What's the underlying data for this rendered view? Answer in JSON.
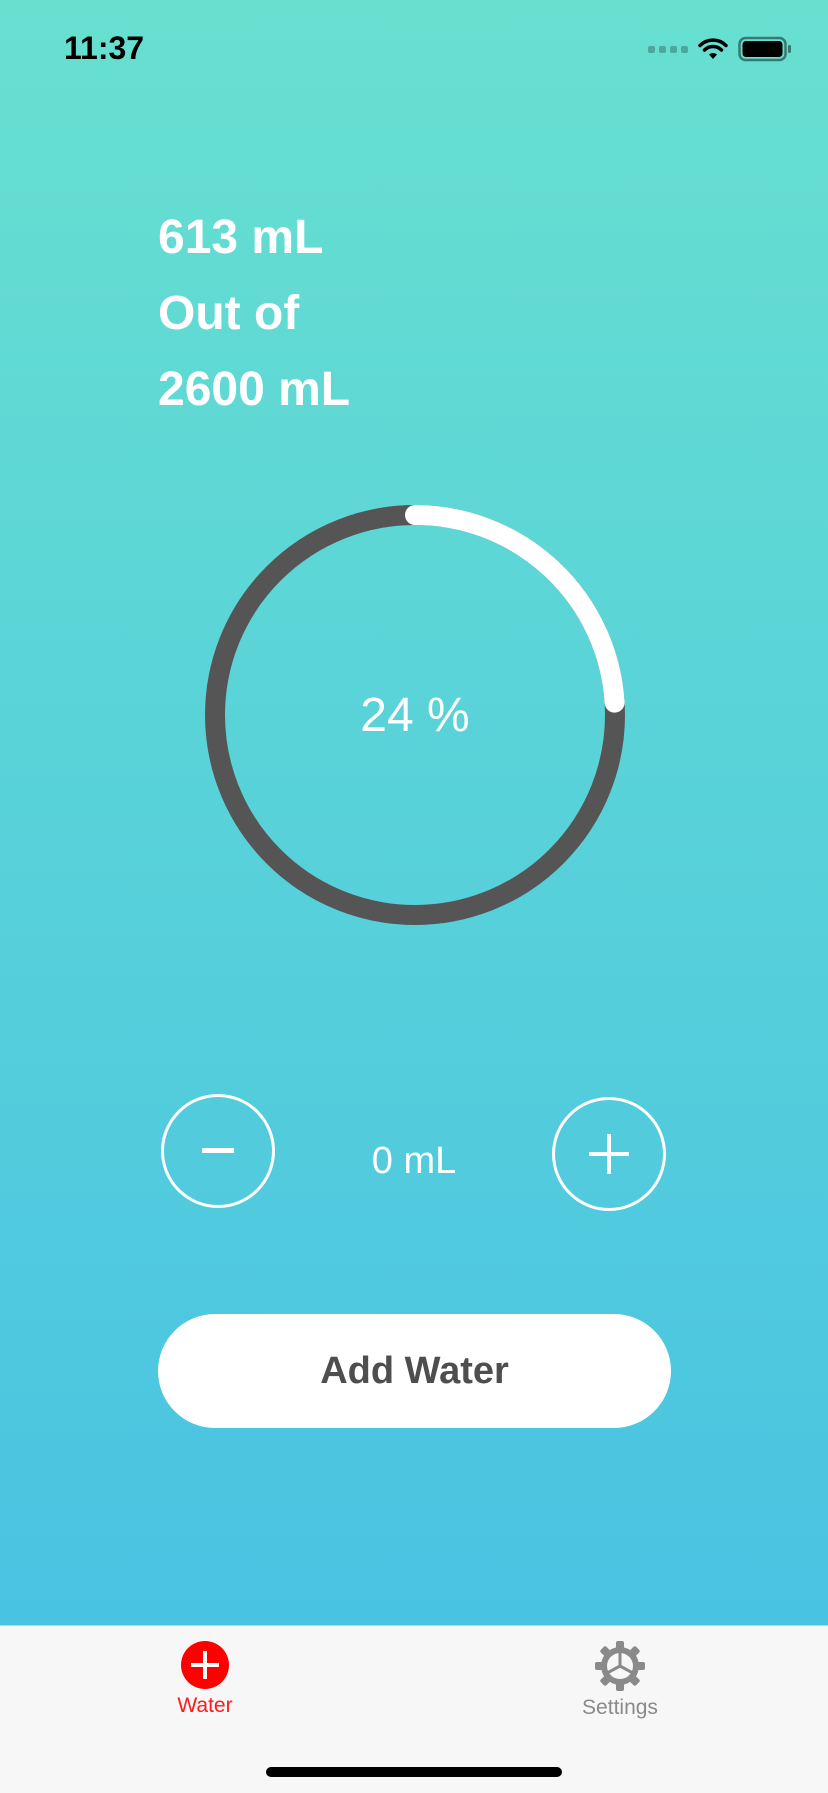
{
  "status_bar": {
    "time": "11:37"
  },
  "stats": {
    "consumed": "613 mL",
    "out_of_label": "Out of",
    "goal": "2600 mL"
  },
  "progress": {
    "label": "24 %",
    "fraction": 0.24
  },
  "stepper": {
    "amount": "0 mL",
    "minus_label": "−",
    "plus_label": "+"
  },
  "add_button": {
    "label": "Add Water"
  },
  "tab_bar": {
    "tabs": [
      {
        "label": "Water",
        "icon": "plus-circle-icon",
        "active": true,
        "color": "#ff1a1a"
      },
      {
        "label": "Settings",
        "icon": "gear-icon",
        "active": false,
        "color": "#8a8a8a"
      }
    ]
  },
  "colors": {
    "gradient_top": "#67e0d0",
    "gradient_bottom": "#49c3e2",
    "track": "#555555",
    "progress": "#ffffff"
  }
}
